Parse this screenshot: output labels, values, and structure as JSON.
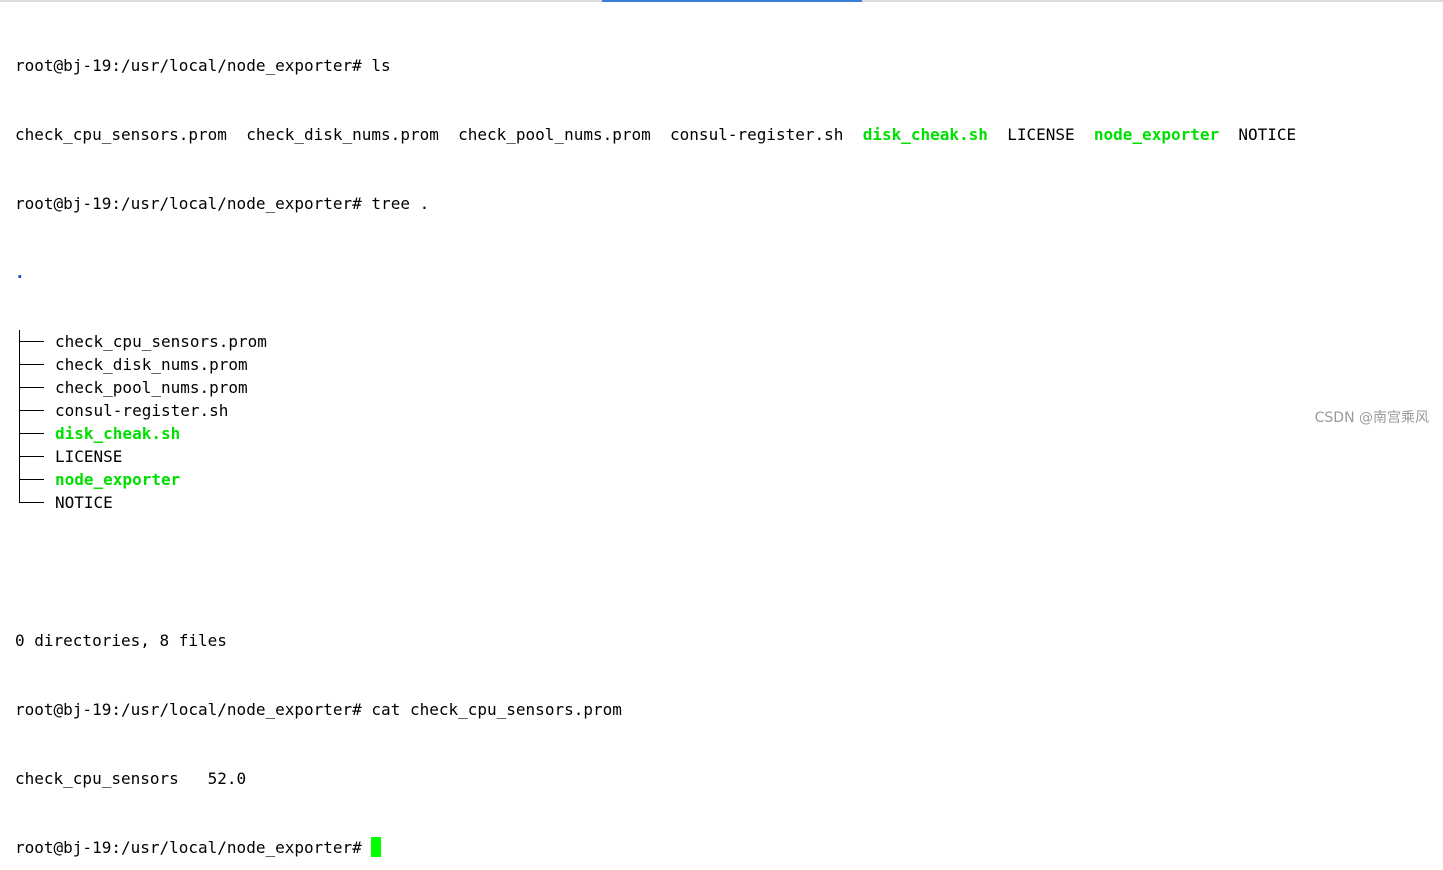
{
  "terminal": {
    "prompt": "root@bj-19:/usr/local/node_exporter#",
    "cmd1": "ls",
    "ls_output": [
      {
        "name": "check_cpu_sensors.prom",
        "exec": false
      },
      {
        "name": "check_disk_nums.prom",
        "exec": false
      },
      {
        "name": "check_pool_nums.prom",
        "exec": false
      },
      {
        "name": "consul-register.sh",
        "exec": false
      },
      {
        "name": "disk_cheak.sh",
        "exec": true
      },
      {
        "name": "LICENSE",
        "exec": false
      },
      {
        "name": "node_exporter",
        "exec": true
      },
      {
        "name": "NOTICE",
        "exec": false
      }
    ],
    "cmd2": "tree .",
    "tree_root": ".",
    "tree_items": [
      {
        "name": "check_cpu_sensors.prom",
        "exec": false
      },
      {
        "name": "check_disk_nums.prom",
        "exec": false
      },
      {
        "name": "check_pool_nums.prom",
        "exec": false
      },
      {
        "name": "consul-register.sh",
        "exec": false
      },
      {
        "name": "disk_cheak.sh",
        "exec": true
      },
      {
        "name": "LICENSE",
        "exec": false
      },
      {
        "name": "node_exporter",
        "exec": true
      },
      {
        "name": "NOTICE",
        "exec": false
      }
    ],
    "tree_summary": "0 directories, 8 files",
    "cmd3": "cat check_cpu_sensors.prom",
    "cat_output": "check_cpu_sensors   52.0",
    "cmd4": ""
  },
  "watermark": "CSDN @南宫乘风",
  "colors": {
    "executable": "#00e000",
    "cursor": "#00ff00",
    "tree_root": "#1f3fd6"
  }
}
